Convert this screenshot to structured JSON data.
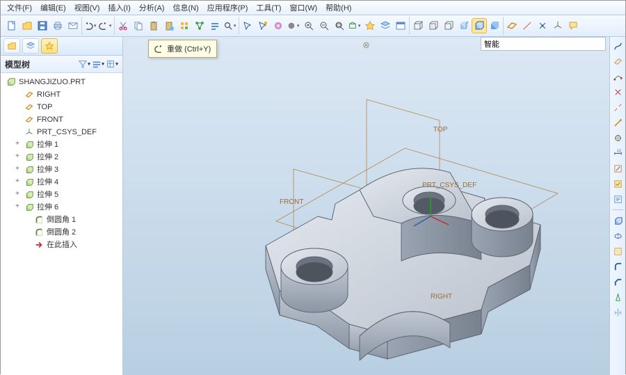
{
  "menu": {
    "file": "文件(F)",
    "edit": "编辑(E)",
    "view": "视图(V)",
    "insert": "插入(I)",
    "analysis": "分析(A)",
    "info": "信息(N)",
    "app": "应用程序(P)",
    "tools": "工具(T)",
    "window": "窗口(W)",
    "help": "帮助(H)"
  },
  "tooltip": {
    "label": "重做",
    "shortcut": "(Ctrl+Y)"
  },
  "search": {
    "placeholder": "",
    "value": "智能"
  },
  "tree": {
    "title": "模型树",
    "root": "SHANGJIZUO.PRT",
    "items": [
      {
        "icon": "datum-plane",
        "label": "RIGHT",
        "indent": 1
      },
      {
        "icon": "datum-plane",
        "label": "TOP",
        "indent": 1
      },
      {
        "icon": "datum-plane",
        "label": "FRONT",
        "indent": 1
      },
      {
        "icon": "csys",
        "label": "PRT_CSYS_DEF",
        "indent": 1
      },
      {
        "icon": "extrude",
        "label": "拉伸 1",
        "indent": 1,
        "tw": "+"
      },
      {
        "icon": "extrude",
        "label": "拉伸 2",
        "indent": 1,
        "tw": "+"
      },
      {
        "icon": "extrude",
        "label": "拉伸 3",
        "indent": 1,
        "tw": "+"
      },
      {
        "icon": "extrude",
        "label": "拉伸 4",
        "indent": 1,
        "tw": "+"
      },
      {
        "icon": "extrude",
        "label": "拉伸 5",
        "indent": 1,
        "tw": "+"
      },
      {
        "icon": "extrude",
        "label": "拉伸 6",
        "indent": 1,
        "tw": "+"
      },
      {
        "icon": "round",
        "label": "倒圆角 1",
        "indent": 2
      },
      {
        "icon": "round",
        "label": "倒圆角 2",
        "indent": 2
      },
      {
        "icon": "insert-here",
        "label": "在此插入",
        "indent": 2
      }
    ]
  },
  "viewport": {
    "labels": {
      "top": "TOP",
      "front": "FRONT",
      "right": "RIGHT",
      "csys": "PRT_CSYS_DEF"
    }
  },
  "rtool_names": [
    "spline-icon",
    "plane-icon",
    "curve-icon",
    "point-icon",
    "axis-red-icon",
    "axis-yellow-icon",
    "sweep-icon",
    "dim-icon",
    "sketch-icon",
    "edit-icon",
    "note-icon",
    "sep",
    "extrude-tool-icon",
    "revolve-icon",
    "shell-icon",
    "round-icon",
    "chamfer-icon",
    "draft-icon",
    "mirror-icon"
  ]
}
